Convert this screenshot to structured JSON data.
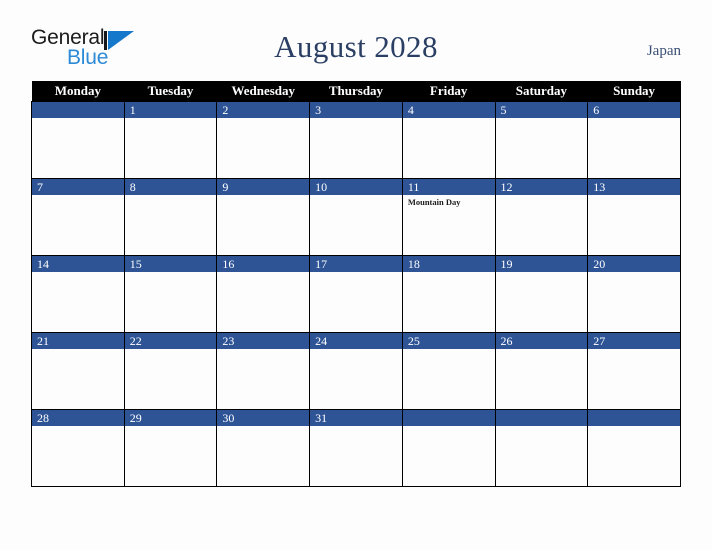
{
  "brand": {
    "name_part1": "General",
    "name_part2": "Blue",
    "triangle_color": "#1678cb",
    "blue_text_color": "#2d8ad6"
  },
  "header": {
    "title": "August 2028",
    "country": "Japan",
    "title_color": "#2a3f63"
  },
  "calendar": {
    "month": "August",
    "year": "2028",
    "accent_color": "#2e5496",
    "header_bg": "#000000",
    "weekday_headers": [
      "Monday",
      "Tuesday",
      "Wednesday",
      "Thursday",
      "Friday",
      "Saturday",
      "Sunday"
    ],
    "weeks": [
      [
        {
          "day": "",
          "events": []
        },
        {
          "day": "1",
          "events": []
        },
        {
          "day": "2",
          "events": []
        },
        {
          "day": "3",
          "events": []
        },
        {
          "day": "4",
          "events": []
        },
        {
          "day": "5",
          "events": []
        },
        {
          "day": "6",
          "events": []
        }
      ],
      [
        {
          "day": "7",
          "events": []
        },
        {
          "day": "8",
          "events": []
        },
        {
          "day": "9",
          "events": []
        },
        {
          "day": "10",
          "events": []
        },
        {
          "day": "11",
          "events": [
            "Mountain Day"
          ]
        },
        {
          "day": "12",
          "events": []
        },
        {
          "day": "13",
          "events": []
        }
      ],
      [
        {
          "day": "14",
          "events": []
        },
        {
          "day": "15",
          "events": []
        },
        {
          "day": "16",
          "events": []
        },
        {
          "day": "17",
          "events": []
        },
        {
          "day": "18",
          "events": []
        },
        {
          "day": "19",
          "events": []
        },
        {
          "day": "20",
          "events": []
        }
      ],
      [
        {
          "day": "21",
          "events": []
        },
        {
          "day": "22",
          "events": []
        },
        {
          "day": "23",
          "events": []
        },
        {
          "day": "24",
          "events": []
        },
        {
          "day": "25",
          "events": []
        },
        {
          "day": "26",
          "events": []
        },
        {
          "day": "27",
          "events": []
        }
      ],
      [
        {
          "day": "28",
          "events": []
        },
        {
          "day": "29",
          "events": []
        },
        {
          "day": "30",
          "events": []
        },
        {
          "day": "31",
          "events": []
        },
        {
          "day": "",
          "events": []
        },
        {
          "day": "",
          "events": []
        },
        {
          "day": "",
          "events": []
        }
      ]
    ]
  }
}
